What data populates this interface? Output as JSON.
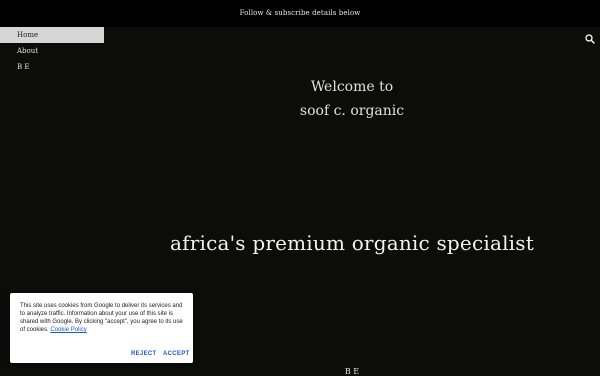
{
  "topbar": {
    "text": "Follow & subscribe details below"
  },
  "nav": {
    "items": [
      {
        "label": "Home",
        "active": true
      },
      {
        "label": "About",
        "active": false
      },
      {
        "label": "B E",
        "active": false
      }
    ]
  },
  "search": {
    "icon": "search-icon"
  },
  "hero": {
    "welcome_line1": "Welcome to",
    "welcome_line2": "soof c. organic",
    "tagline": "africa's premium organic specialist",
    "footer_mark": "B E"
  },
  "cookie_banner": {
    "text": "This site uses cookies from Google to deliver its services and to analyze traffic. Information about your use of this site is shared with Google. By clicking \"accept\", you agree to its use of cookies.",
    "link_text": "Cookie Policy",
    "reject_label": "REJECT",
    "accept_label": "ACCEPT"
  },
  "colors": {
    "background": "#0c0c0a",
    "topbar": "#000000",
    "nav_active_bg": "#d6d6d6",
    "link_blue": "#1a57d6"
  }
}
